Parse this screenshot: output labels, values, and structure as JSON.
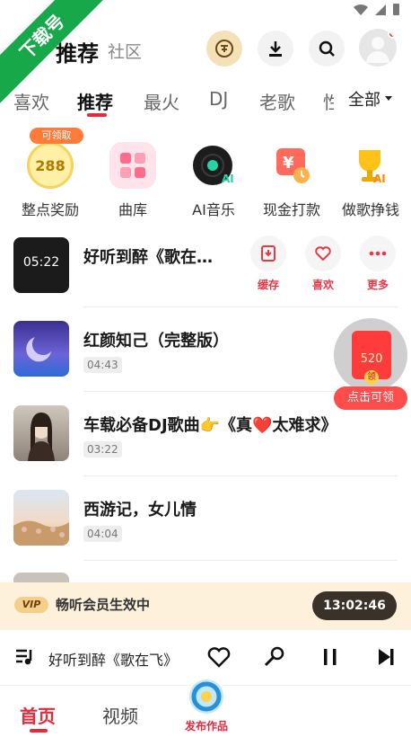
{
  "watermark": "下载号",
  "header": {
    "title": "推荐",
    "subtitle": "社区"
  },
  "tabs": [
    {
      "label": "喜欢"
    },
    {
      "label": "推荐"
    },
    {
      "label": "最火"
    },
    {
      "label": "DJ"
    },
    {
      "label": "老歌"
    },
    {
      "label": "性"
    }
  ],
  "tab_all": "全部",
  "quick_entries": [
    {
      "label": "整点奖励",
      "badge": "可领取",
      "coin": "288"
    },
    {
      "label": "曲库"
    },
    {
      "label": "AI音乐"
    },
    {
      "label": "现金打款"
    },
    {
      "label": "做歌挣钱"
    }
  ],
  "songs": [
    {
      "title": "好听到醉《歌在…",
      "cover_time": "05:22"
    },
    {
      "title": "红颜知己（完整版）",
      "duration": "04:43"
    },
    {
      "title": "车载必备DJ歌曲👉《真❤️太难求》",
      "duration": "03:22"
    },
    {
      "title": "西游记，女儿情",
      "duration": "04:04"
    }
  ],
  "song_actions": {
    "save": "缓存",
    "like": "喜欢",
    "more": "更多"
  },
  "red_packet": {
    "amount": "520",
    "token": "领",
    "cta": "点击可领"
  },
  "vip": {
    "badge": "VIP",
    "text": "畅听会员生效中",
    "timer": "13:02:46"
  },
  "player": {
    "now_playing": "好听到醉《歌在飞》"
  },
  "nav": {
    "home": "首页",
    "video": "视频",
    "publish": "发布作品"
  },
  "colors": {
    "accent": "#e8283b",
    "vip_bg": "#fdf1dc",
    "timer_bg": "#3a3128"
  }
}
